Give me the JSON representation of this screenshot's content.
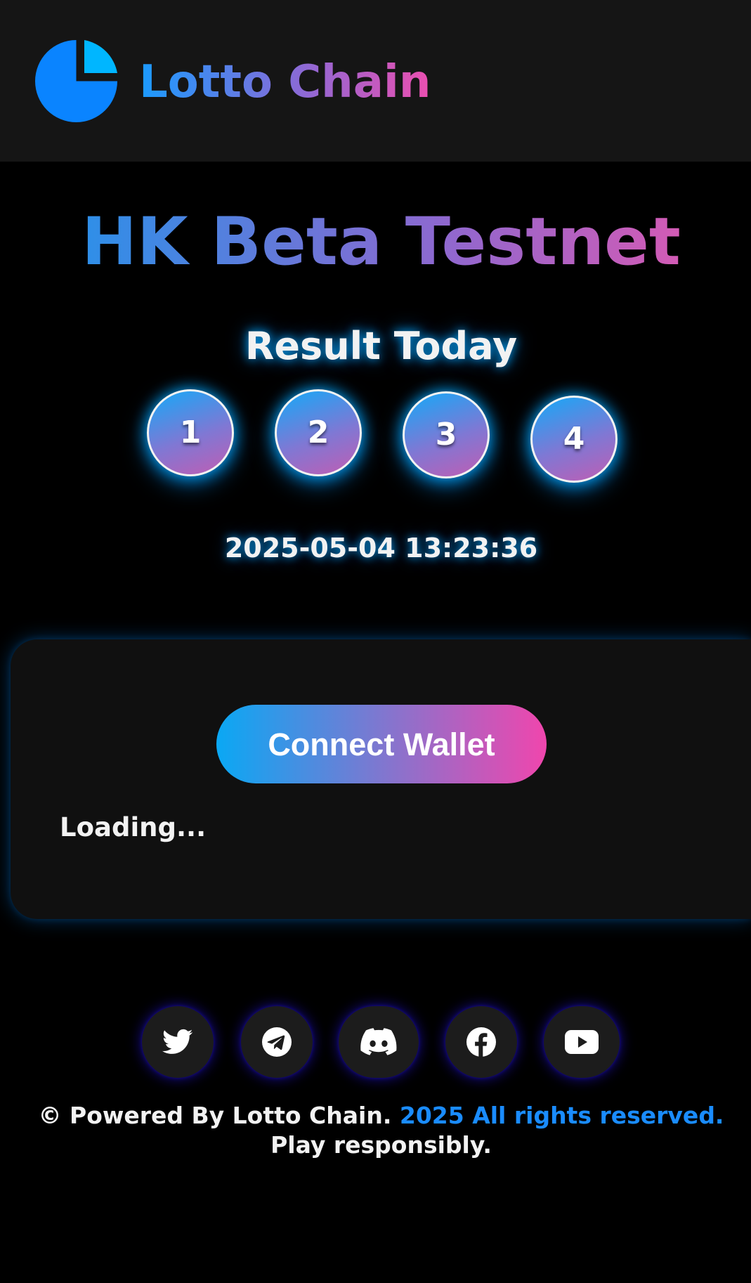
{
  "header": {
    "brand_name": "Lotto Chain",
    "logo_icon": "pie-chart-icon"
  },
  "main": {
    "title": "HK Beta Testnet",
    "result_title": "Result Today",
    "result_numbers": [
      "1",
      "2",
      "3",
      "4"
    ],
    "result_timestamp": "2025-05-04 13:23:36"
  },
  "panel": {
    "connect_wallet_label": "Connect Wallet",
    "status_text": "Loading..."
  },
  "social_links": [
    {
      "name": "Twitter",
      "icon": "twitter-icon"
    },
    {
      "name": "Telegram",
      "icon": "telegram-icon"
    },
    {
      "name": "Discord",
      "icon": "discord-icon"
    },
    {
      "name": "Facebook",
      "icon": "facebook-icon"
    },
    {
      "name": "YouTube",
      "icon": "youtube-icon"
    }
  ],
  "footer": {
    "text_before": "© Powered By Lotto Chain. ",
    "highlight": "2025 All rights reserved.",
    "text_after": " Play responsibly."
  },
  "colors": {
    "page_background": "#000000",
    "header_background": "#151515",
    "panel_background": "#101010",
    "accent_blue": "#1a8cff",
    "accent_pink": "#ec4fb0",
    "glow_cyan": "#00aaff"
  }
}
